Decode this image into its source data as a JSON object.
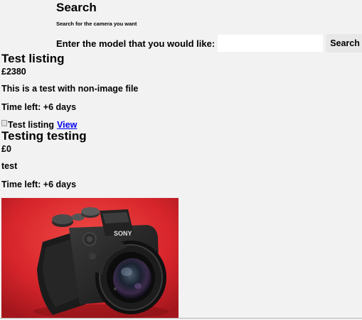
{
  "search": {
    "title": "Search",
    "subtitle": "Search for the camera you want",
    "label": "Enter the model that you would like:",
    "input_value": "",
    "input_placeholder": "",
    "button_label": "Search"
  },
  "listings": [
    {
      "title": "Test listing",
      "price": "£2380",
      "description": "This is a test with non-image file",
      "time_left": "Time left: +6 days",
      "image_alt": "Test listing",
      "view_label": "View"
    },
    {
      "title": "Testing testing",
      "price": "£0",
      "description": "test",
      "time_left": "Time left: +6 days",
      "image_brand_text": "SONY"
    }
  ],
  "colors": {
    "page_background": "#f2f2f2",
    "link": "#0000ee",
    "photo_background": "#d8262c"
  }
}
